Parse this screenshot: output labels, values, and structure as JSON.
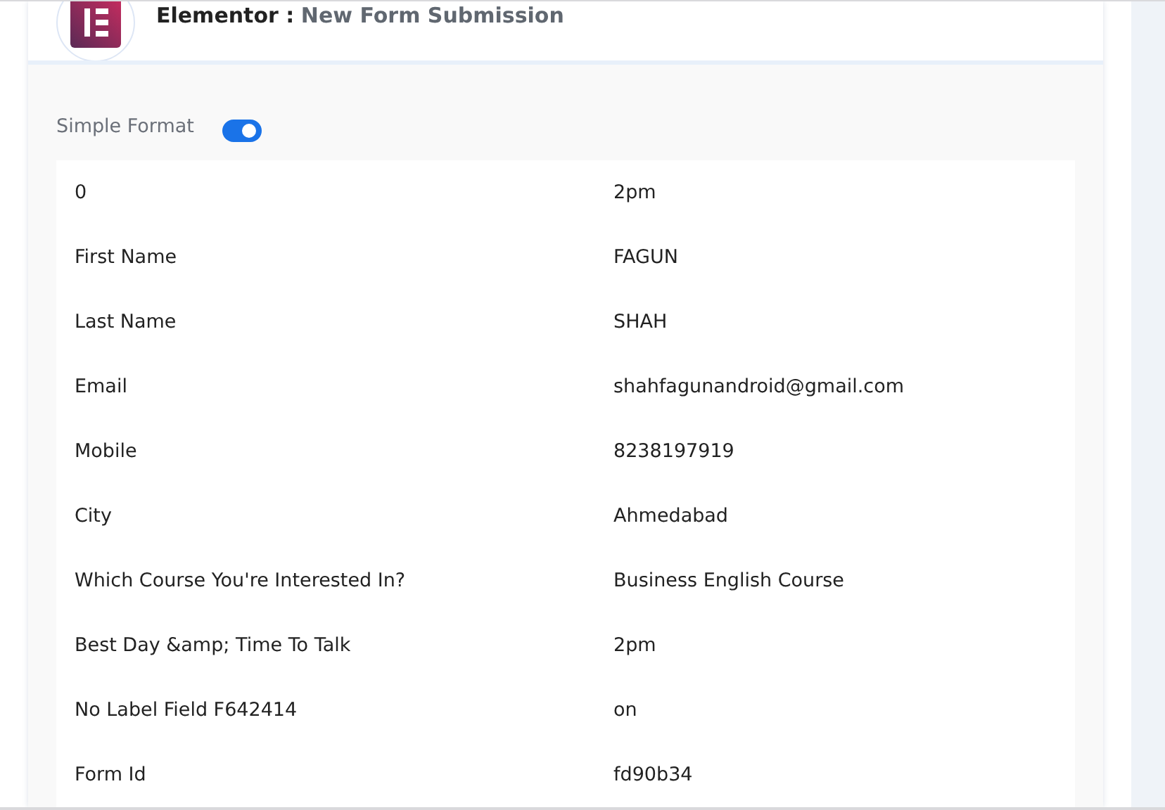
{
  "header": {
    "app": "Elementor :",
    "event": "New Form Submission"
  },
  "format_toggle": {
    "label": "Simple Format",
    "on": true
  },
  "fields": [
    {
      "label": "0",
      "value": "2pm"
    },
    {
      "label": "First Name",
      "value": "FAGUN"
    },
    {
      "label": "Last Name",
      "value": "SHAH"
    },
    {
      "label": "Email",
      "value": "shahfagunandroid@gmail.com"
    },
    {
      "label": "Mobile",
      "value": "8238197919"
    },
    {
      "label": "City",
      "value": "Ahmedabad"
    },
    {
      "label": "Which Course You're Interested In?",
      "value": "Business English Course"
    },
    {
      "label": "Best Day &amp; Time To Talk",
      "value": "2pm"
    },
    {
      "label": "No Label Field F642414",
      "value": "on"
    },
    {
      "label": "Form Id",
      "value": "fd90b34"
    }
  ]
}
